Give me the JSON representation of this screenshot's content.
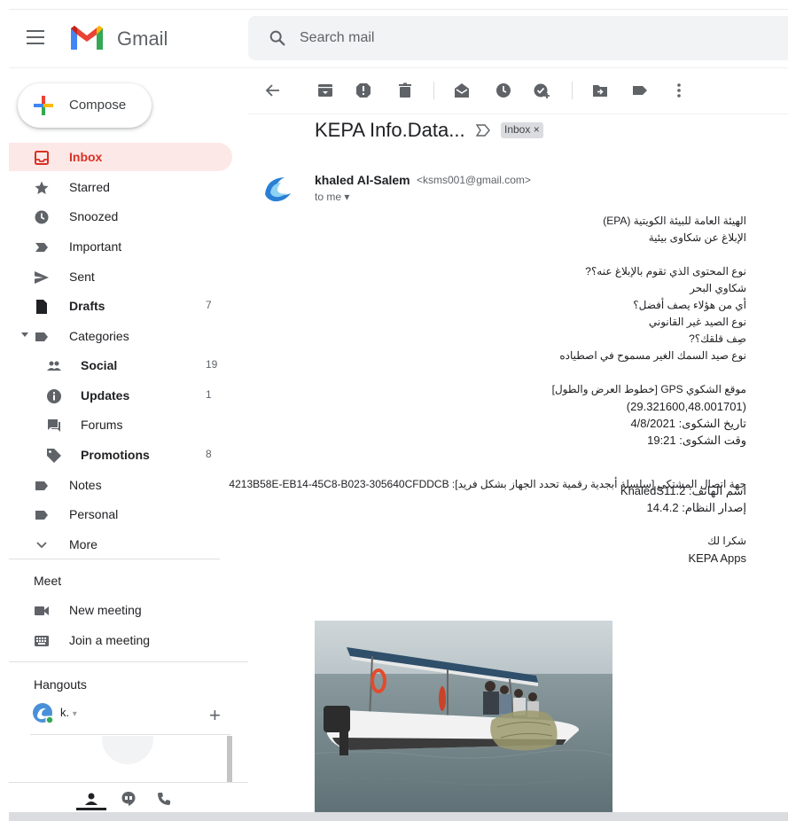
{
  "app": {
    "name": "Gmail"
  },
  "search": {
    "placeholder": "Search mail"
  },
  "compose": {
    "label": "Compose"
  },
  "sidebar": {
    "items": [
      {
        "label": "Inbox",
        "count": ""
      },
      {
        "label": "Starred",
        "count": ""
      },
      {
        "label": "Snoozed",
        "count": ""
      },
      {
        "label": "Important",
        "count": ""
      },
      {
        "label": "Sent",
        "count": ""
      },
      {
        "label": "Drafts",
        "count": "7"
      },
      {
        "label": "Categories",
        "count": ""
      },
      {
        "label": "Social",
        "count": "19"
      },
      {
        "label": "Updates",
        "count": "1"
      },
      {
        "label": "Forums",
        "count": ""
      },
      {
        "label": "Promotions",
        "count": "8"
      },
      {
        "label": "Notes",
        "count": ""
      },
      {
        "label": "Personal",
        "count": ""
      },
      {
        "label": "More",
        "count": ""
      }
    ]
  },
  "meet": {
    "title": "Meet",
    "new_meeting": "New meeting",
    "join_meeting": "Join a meeting"
  },
  "hangouts": {
    "title": "Hangouts",
    "user": "k."
  },
  "email": {
    "subject": "KEPA Info.Data...",
    "label_chip": "Inbox ×",
    "sender_name": "khaled Al-Salem",
    "sender_email": "<ksms001@gmail.com>",
    "recipient": "to me ▾",
    "body": {
      "line1": "الهيئة العامة للبيئة الكويتية (EPA)",
      "line2": "الإبلاغ عن شكاوى بيئية",
      "line3": "نوع المحتوى الذي تقوم بالإبلاغ عنه؟?",
      "line4": "شكاوي البحر",
      "line5": "أي من هؤلاء يصف أفضل؟",
      "line6": "نوع الصيد غير القانوني",
      "line7": "صِف قلقك؟?",
      "line8": "نوع صيد السمك الغير مسموح في اصطياده",
      "line9": "موقع الشكوي  GPS [خطوط العرض والطول]",
      "line10": "(29.321600,48.001701)",
      "line11": "تاريخ الشكوى: 4/8/2021",
      "line12": "وقت الشكوى: 19:21",
      "line13": "جهة اتصال المشتكي [سلسلة أبجدية رقمية تحدد الجهاز بشكل فريد]: 4213B58E-EB14-45C8-B023-305640CFDDCB",
      "line14": "اسم الهاتف: KhaledS11.2",
      "line15": "إصدار النظام: 14.4.2",
      "line16": "شكرا لك",
      "line17": "KEPA Apps"
    }
  },
  "colors": {
    "accent_red": "#d93025",
    "active_bg": "#fce8e6",
    "icon_gray": "#5f6368"
  }
}
